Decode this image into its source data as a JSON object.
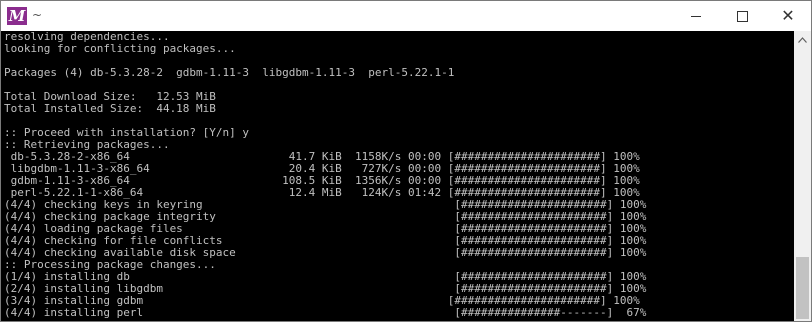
{
  "window": {
    "title": "~",
    "app_icon_letter": "M",
    "app_icon_color": "#8b2d8e",
    "controls": {
      "minimize": "minimize-icon",
      "maximize": "maximize-icon",
      "close": "close-icon"
    }
  },
  "terminal": {
    "foreground": "#c0c0c0",
    "background": "#000000",
    "lines": [
      "resolving dependencies...",
      "looking for conflicting packages...",
      "",
      "Packages (4) db-5.3.28-2  gdbm-1.11-3  libgdbm-1.11-3  perl-5.22.1-1",
      "",
      "Total Download Size:   12.53 MiB",
      "Total Installed Size:  44.18 MiB",
      "",
      ":: Proceed with installation? [Y/n] y",
      ":: Retrieving packages...",
      " db-5.3.28-2-x86_64                        41.7 KiB  1158K/s 00:00 [######################] 100%",
      " libgdbm-1.11-3-x86_64                     20.4 KiB   727K/s 00:00 [######################] 100%",
      " gdbm-1.11-3-x86_64                       108.5 KiB  1356K/s 00:00 [######################] 100%",
      " perl-5.22.1-1-x86_64                      12.4 MiB   124K/s 01:42 [######################] 100%",
      "(4/4) checking keys in keyring                                      [######################] 100%",
      "(4/4) checking package integrity                                    [######################] 100%",
      "(4/4) loading package files                                         [######################] 100%",
      "(4/4) checking for file conflicts                                   [######################] 100%",
      "(4/4) checking available disk space                                 [######################] 100%",
      ":: Processing package changes...",
      "(1/4) installing db                                                 [######################] 100%",
      "(2/4) installing libgdbm                                            [######################] 100%",
      "(3/4) installing gdbm                                              [######################] 100%",
      "(4/4) installing perl                                               [###############-------]  67%"
    ]
  },
  "scrollbar": {
    "up_icon": "chevron-up-icon"
  }
}
